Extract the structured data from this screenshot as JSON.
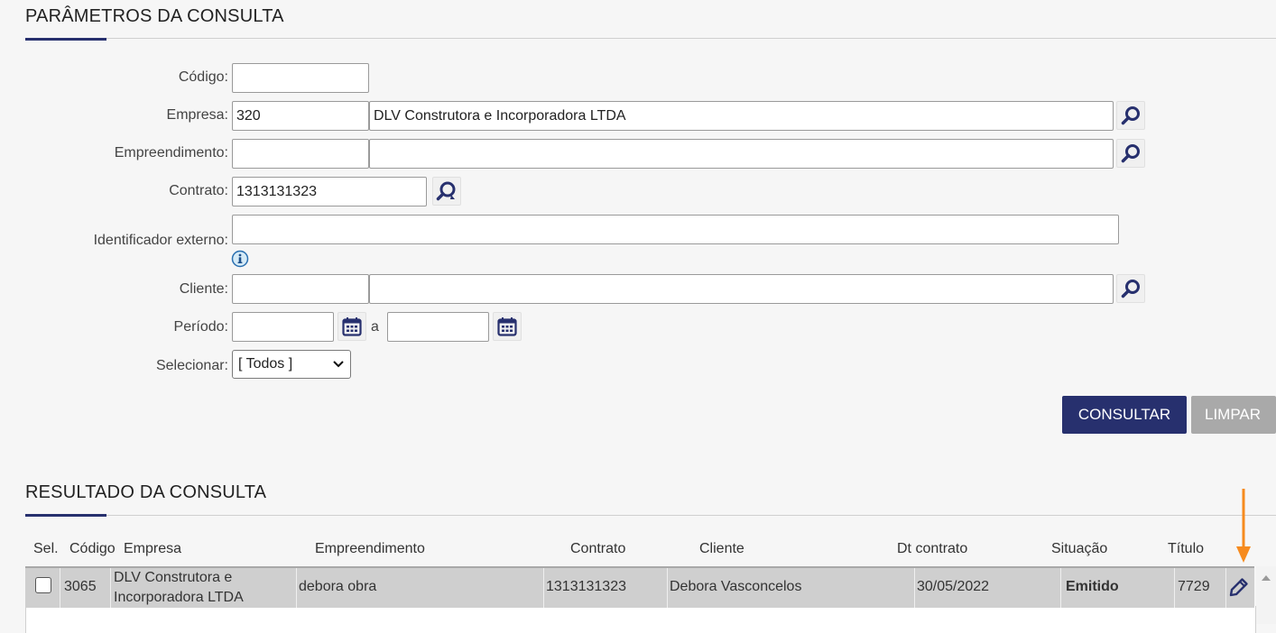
{
  "params": {
    "title": "PARÂMETROS DA CONSULTA",
    "codigo": {
      "label": "Código:",
      "value": ""
    },
    "empresa": {
      "label": "Empresa:",
      "code": "320",
      "name": "DLV Construtora e Incorporadora LTDA"
    },
    "empreendimento": {
      "label": "Empreendimento:",
      "code": "",
      "name": ""
    },
    "contrato": {
      "label": "Contrato:",
      "value": "1313131323"
    },
    "identificador": {
      "label": "Identificador externo:",
      "value": ""
    },
    "cliente": {
      "label": "Cliente:",
      "code": "",
      "name": ""
    },
    "periodo": {
      "label": "Período:",
      "start": "",
      "sep": "a",
      "end": ""
    },
    "selecionar": {
      "label": "Selecionar:",
      "value": "[ Todos ]"
    },
    "consultar_label": "CONSULTAR",
    "limpar_label": "LIMPAR"
  },
  "result": {
    "title": "RESULTADO DA CONSULTA",
    "columns": [
      "Sel.",
      "Código",
      "Empresa",
      "Empreendimento",
      "Contrato",
      "Cliente",
      "Dt contrato",
      "Situação",
      "Título"
    ],
    "rows": [
      {
        "codigo": "3065",
        "empresa_l1": "DLV Construtora e",
        "empresa_l2": "Incorporadora LTDA",
        "empreendimento": "debora obra",
        "contrato": "1313131323",
        "cliente": "Debora Vasconcelos",
        "dt_contrato": "30/05/2022",
        "situacao": "Emitido",
        "titulo": "7729"
      }
    ]
  },
  "icons": {
    "search": "search-icon",
    "search_refresh": "search-refresh-icon",
    "info": "info-icon",
    "calendar": "calendar-icon",
    "edit": "pencil-icon",
    "arrow": "arrow-down-icon"
  },
  "colors": {
    "primary": "#27306e",
    "disabled": "#a9a9a9",
    "annotation_arrow": "#f68b1f"
  }
}
